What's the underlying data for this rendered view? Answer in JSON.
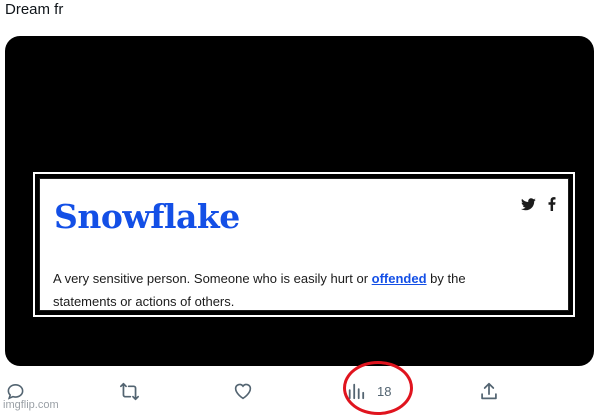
{
  "tweet": {
    "text": "Dream fr"
  },
  "media_card": {
    "title": "Snowflake",
    "definition_before": "A very sensitive person. Someone who is easily hurt or ",
    "definition_link": "offended",
    "definition_after": " by the statements or actions of others.",
    "share_icons": [
      "twitter-icon",
      "facebook-icon"
    ]
  },
  "actions": {
    "reply_icon": "reply-icon",
    "retweet_icon": "retweet-icon",
    "like_icon": "heart-icon",
    "views_icon": "views-chart-icon",
    "views_count": "18",
    "share_icon": "share-icon"
  },
  "annotation": {
    "color": "#e0141e"
  },
  "colors": {
    "brand_blue": "#134fe6",
    "action_gray": "#536471"
  },
  "watermark": "imgflip.com"
}
